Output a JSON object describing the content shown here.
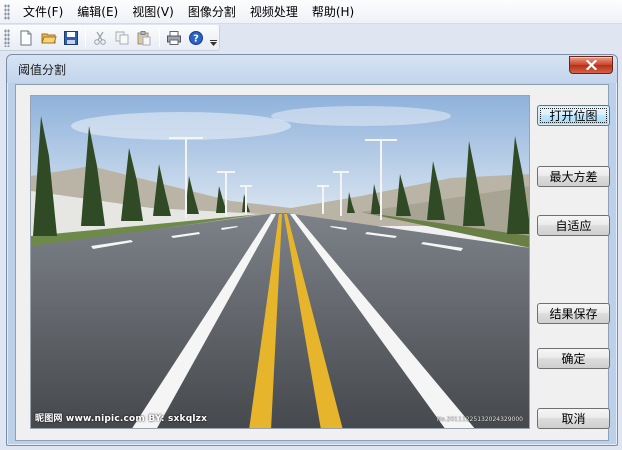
{
  "menubar": {
    "items": [
      {
        "label": "文件(F)"
      },
      {
        "label": "编辑(E)"
      },
      {
        "label": "视图(V)"
      },
      {
        "label": "图像分割"
      },
      {
        "label": "视频处理"
      },
      {
        "label": "帮助(H)"
      }
    ]
  },
  "toolbar": {
    "icons": [
      "new-file-icon",
      "open-folder-icon",
      "save-icon",
      "cut-icon",
      "copy-icon",
      "paste-icon",
      "print-icon",
      "help-icon",
      "overflow-chevron-icon"
    ]
  },
  "dialog": {
    "title": "阈值分割",
    "close_icon": "close-icon",
    "image": {
      "watermark_left": "昵图网 www.nipic.com    BY: sxkqlzx",
      "watermark_right": "No.20111225132024329000"
    },
    "buttons": {
      "open_image": "打开位图",
      "max_variance": "最大方差",
      "adaptive": "自适应",
      "save_result": "结果保存",
      "confirm": "确定",
      "cancel": "取消"
    }
  },
  "colors": {
    "dialog_frame": "#bcd0ea",
    "client_bg": "#f0f0f0",
    "close_button": "#c9432a",
    "focused_button": "#bee6fd"
  }
}
